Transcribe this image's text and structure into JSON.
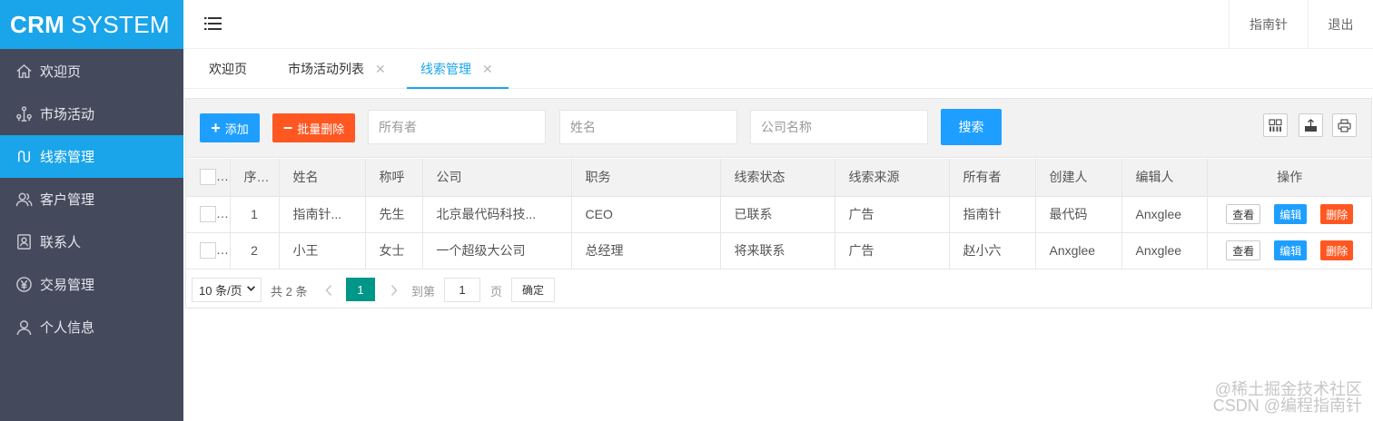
{
  "app": {
    "logo_bold": "CRM",
    "logo_rest": "SYSTEM"
  },
  "sidebar": {
    "items": [
      {
        "label": "欢迎页",
        "icon": "home-icon"
      },
      {
        "label": "市场活动",
        "icon": "network-icon"
      },
      {
        "label": "线索管理",
        "icon": "clue-icon",
        "active": true
      },
      {
        "label": "客户管理",
        "icon": "users-icon"
      },
      {
        "label": "联系人",
        "icon": "contact-card-icon"
      },
      {
        "label": "交易管理",
        "icon": "yen-icon"
      },
      {
        "label": "个人信息",
        "icon": "user-icon"
      }
    ]
  },
  "header": {
    "guide_label": "指南针",
    "exit_label": "退出"
  },
  "tabs": [
    {
      "label": "欢迎页",
      "closable": false
    },
    {
      "label": "市场活动列表",
      "closable": true
    },
    {
      "label": "线索管理",
      "closable": true,
      "active": true
    }
  ],
  "toolbar": {
    "add_label": "添加",
    "batch_delete_label": "批量删除",
    "owner_placeholder": "所有者",
    "name_placeholder": "姓名",
    "company_placeholder": "公司名称",
    "search_label": "搜索",
    "icons": [
      "columns-icon",
      "export-icon",
      "print-icon"
    ]
  },
  "table": {
    "headers": [
      "序号",
      "姓名",
      "称呼",
      "公司",
      "职务",
      "线索状态",
      "线索来源",
      "所有者",
      "创建人",
      "编辑人",
      "操作"
    ],
    "rows": [
      [
        "1",
        "指南针...",
        "先生",
        "北京最代码科技...",
        "CEO",
        "已联系",
        "广告",
        "指南针",
        "最代码",
        "Anxglee"
      ],
      [
        "2",
        "小王",
        "女士",
        "一个超级大公司",
        "总经理",
        "将来联系",
        "广告",
        "赵小六",
        "Anxglee",
        "Anxglee"
      ]
    ],
    "actions": {
      "view": "查看",
      "edit": "编辑",
      "delete": "删除"
    }
  },
  "pager": {
    "page_size": "10 条/页",
    "total": "共 2 条",
    "current_page": "1",
    "goto_label": "到第",
    "goto_value": "1",
    "page_unit": "页",
    "confirm_label": "确定"
  },
  "watermark": {
    "line1": "@稀土掘金技术社区",
    "line2": "CSDN @编程指南针"
  },
  "colors": {
    "accent": "#1aa5ea",
    "primary_btn": "#1e9fff",
    "danger_btn": "#ff5722",
    "sidebar_bg": "#444a5c",
    "page_active": "#009688"
  }
}
